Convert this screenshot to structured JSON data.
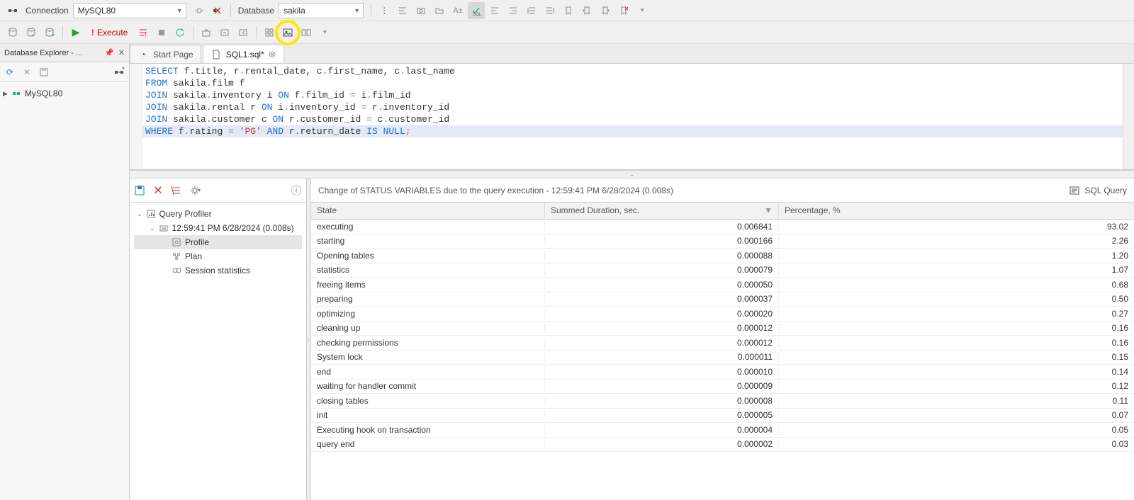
{
  "toolbar": {
    "connection_label": "Connection",
    "connection_value": "MySQL80",
    "database_label": "Database",
    "database_value": "sakila",
    "execute_label": "Execute"
  },
  "sidebar": {
    "title": "Database Explorer - ...",
    "connection": "MySQL80"
  },
  "tabs": {
    "start": "Start Page",
    "sql": "SQL1.sql*"
  },
  "sql_lines": [
    [
      {
        "t": "SELECT",
        "c": "kw"
      },
      {
        "t": " f",
        "c": "id"
      },
      {
        "t": ".",
        "c": "op"
      },
      {
        "t": "title",
        "c": "id"
      },
      {
        "t": ", r",
        "c": "id"
      },
      {
        "t": ".",
        "c": "op"
      },
      {
        "t": "rental_date",
        "c": "id"
      },
      {
        "t": ", c",
        "c": "id"
      },
      {
        "t": ".",
        "c": "op"
      },
      {
        "t": "first_name",
        "c": "id"
      },
      {
        "t": ", c",
        "c": "id"
      },
      {
        "t": ".",
        "c": "op"
      },
      {
        "t": "last_name",
        "c": "id"
      }
    ],
    [
      {
        "t": "FROM",
        "c": "kw"
      },
      {
        "t": " sakila",
        "c": "id"
      },
      {
        "t": ".",
        "c": "op"
      },
      {
        "t": "film f",
        "c": "id"
      }
    ],
    [
      {
        "t": "JOIN",
        "c": "kw"
      },
      {
        "t": " sakila",
        "c": "id"
      },
      {
        "t": ".",
        "c": "op"
      },
      {
        "t": "inventory i ",
        "c": "id"
      },
      {
        "t": "ON",
        "c": "kw"
      },
      {
        "t": " f",
        "c": "id"
      },
      {
        "t": ".",
        "c": "op"
      },
      {
        "t": "film_id ",
        "c": "id"
      },
      {
        "t": "=",
        "c": "op"
      },
      {
        "t": " i",
        "c": "id"
      },
      {
        "t": ".",
        "c": "op"
      },
      {
        "t": "film_id",
        "c": "id"
      }
    ],
    [
      {
        "t": "JOIN",
        "c": "kw"
      },
      {
        "t": " sakila",
        "c": "id"
      },
      {
        "t": ".",
        "c": "op"
      },
      {
        "t": "rental r ",
        "c": "id"
      },
      {
        "t": "ON",
        "c": "kw"
      },
      {
        "t": " i",
        "c": "id"
      },
      {
        "t": ".",
        "c": "op"
      },
      {
        "t": "inventory_id ",
        "c": "id"
      },
      {
        "t": "=",
        "c": "op"
      },
      {
        "t": " r",
        "c": "id"
      },
      {
        "t": ".",
        "c": "op"
      },
      {
        "t": "inventory_id",
        "c": "id"
      }
    ],
    [
      {
        "t": "JOIN",
        "c": "kw"
      },
      {
        "t": " sakila",
        "c": "id"
      },
      {
        "t": ".",
        "c": "op"
      },
      {
        "t": "customer c ",
        "c": "id"
      },
      {
        "t": "ON",
        "c": "kw"
      },
      {
        "t": " r",
        "c": "id"
      },
      {
        "t": ".",
        "c": "op"
      },
      {
        "t": "customer_id ",
        "c": "id"
      },
      {
        "t": "=",
        "c": "op"
      },
      {
        "t": " c",
        "c": "id"
      },
      {
        "t": ".",
        "c": "op"
      },
      {
        "t": "customer_id",
        "c": "id"
      }
    ],
    [
      {
        "t": "WHERE",
        "c": "kw"
      },
      {
        "t": " f",
        "c": "id"
      },
      {
        "t": ".",
        "c": "op"
      },
      {
        "t": "rating ",
        "c": "id"
      },
      {
        "t": "=",
        "c": "op"
      },
      {
        "t": " 'PG'",
        "c": "str"
      },
      {
        "t": " AND",
        "c": "kw"
      },
      {
        "t": " r",
        "c": "id"
      },
      {
        "t": ".",
        "c": "op"
      },
      {
        "t": "return_date ",
        "c": "id"
      },
      {
        "t": "IS NULL",
        "c": "kw"
      },
      {
        "t": ";",
        "c": "op"
      }
    ]
  ],
  "profiler": {
    "root": "Query Profiler",
    "run": "12:59:41 PM 6/28/2024  (0.008s)",
    "nodes": {
      "profile": "Profile",
      "plan": "Plan",
      "session": "Session statistics"
    }
  },
  "results": {
    "message": "Change of STATUS VARIABLES due to the query execution - 12:59:41 PM 6/28/2024 (0.008s)",
    "sql_query": "SQL Query",
    "columns": {
      "state": "State",
      "duration": "Summed Duration, sec.",
      "percentage": "Percentage, %"
    },
    "rows": [
      {
        "state": "executing",
        "dur": "0.006841",
        "pct": "93.02"
      },
      {
        "state": "starting",
        "dur": "0.000166",
        "pct": "2.26"
      },
      {
        "state": "Opening tables",
        "dur": "0.000088",
        "pct": "1.20"
      },
      {
        "state": "statistics",
        "dur": "0.000079",
        "pct": "1.07"
      },
      {
        "state": "freeing items",
        "dur": "0.000050",
        "pct": "0.68"
      },
      {
        "state": "preparing",
        "dur": "0.000037",
        "pct": "0.50"
      },
      {
        "state": "optimizing",
        "dur": "0.000020",
        "pct": "0.27"
      },
      {
        "state": "cleaning up",
        "dur": "0.000012",
        "pct": "0.16"
      },
      {
        "state": "checking permissions",
        "dur": "0.000012",
        "pct": "0.16"
      },
      {
        "state": "System lock",
        "dur": "0.000011",
        "pct": "0.15"
      },
      {
        "state": "end",
        "dur": "0.000010",
        "pct": "0.14"
      },
      {
        "state": "waiting for handler commit",
        "dur": "0.000009",
        "pct": "0.12"
      },
      {
        "state": "closing tables",
        "dur": "0.000008",
        "pct": "0.11"
      },
      {
        "state": "init",
        "dur": "0.000005",
        "pct": "0.07"
      },
      {
        "state": "Executing hook on transaction",
        "dur": "0.000004",
        "pct": "0.05"
      },
      {
        "state": "query end",
        "dur": "0.000002",
        "pct": "0.03"
      }
    ]
  },
  "chart_data": {
    "type": "table",
    "title": "Change of STATUS VARIABLES due to the query execution",
    "columns": [
      "State",
      "Summed Duration, sec.",
      "Percentage, %"
    ],
    "rows": [
      [
        "executing",
        0.006841,
        93.02
      ],
      [
        "starting",
        0.000166,
        2.26
      ],
      [
        "Opening tables",
        8.8e-05,
        1.2
      ],
      [
        "statistics",
        7.9e-05,
        1.07
      ],
      [
        "freeing items",
        5e-05,
        0.68
      ],
      [
        "preparing",
        3.7e-05,
        0.5
      ],
      [
        "optimizing",
        2e-05,
        0.27
      ],
      [
        "cleaning up",
        1.2e-05,
        0.16
      ],
      [
        "checking permissions",
        1.2e-05,
        0.16
      ],
      [
        "System lock",
        1.1e-05,
        0.15
      ],
      [
        "end",
        1e-05,
        0.14
      ],
      [
        "waiting for handler commit",
        9e-06,
        0.12
      ],
      [
        "closing tables",
        8e-06,
        0.11
      ],
      [
        "init",
        5e-06,
        0.07
      ],
      [
        "Executing hook on transaction",
        4e-06,
        0.05
      ],
      [
        "query end",
        2e-06,
        0.03
      ]
    ]
  }
}
